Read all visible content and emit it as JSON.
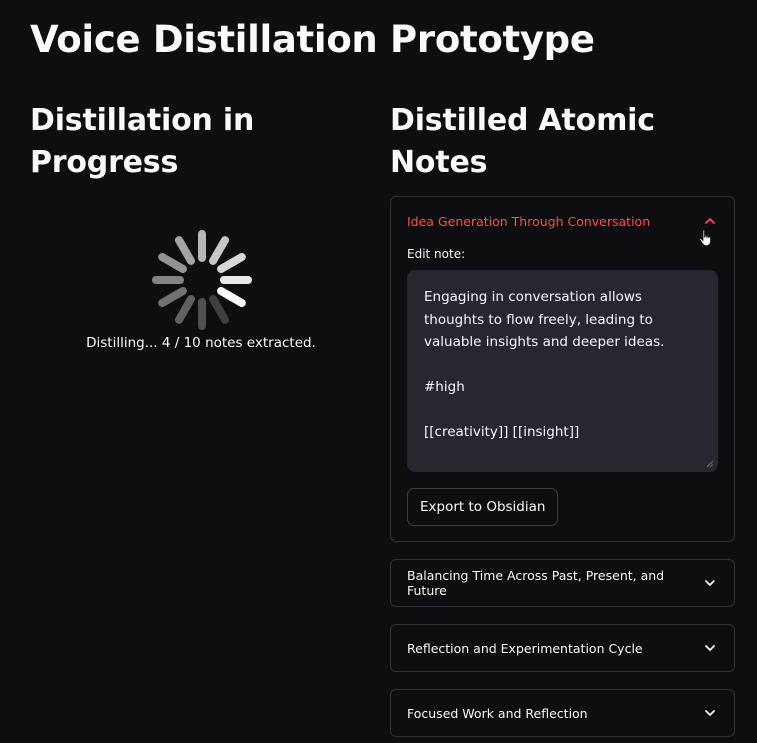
{
  "app": {
    "title": "Voice Distillation Prototype"
  },
  "left_panel": {
    "heading": "Distillation in Progress",
    "status": "Distilling... 4 / 10 notes extracted.",
    "spinner_icon": "loading-spinner-icon"
  },
  "right_panel": {
    "heading": "Distilled Atomic Notes",
    "notes": [
      {
        "title": "Idea Generation Through Conversation",
        "expanded": true,
        "edit_label": "Edit note:",
        "content": "Engaging in conversation allows\nthoughts to flow freely, leading to\nvaluable insights and deeper ideas.\n\n#high\n\n[[creativity]] [[insight]]",
        "export_label": "Export to Obsidian"
      },
      {
        "title": "Balancing Time Across Past, Present, and Future",
        "expanded": false
      },
      {
        "title": "Reflection and Experimentation Cycle",
        "expanded": false
      },
      {
        "title": "Focused Work and Reflection",
        "expanded": false
      }
    ]
  },
  "colors": {
    "background": "#0e0e10",
    "text": "#fafafa",
    "accent": "#ff4b4b",
    "input_bg": "#262730",
    "border": "#2e3037"
  },
  "icons": {
    "chevron_up": "chevron-up-icon",
    "chevron_down": "chevron-down-icon",
    "cursor": "hand-pointer-icon"
  }
}
